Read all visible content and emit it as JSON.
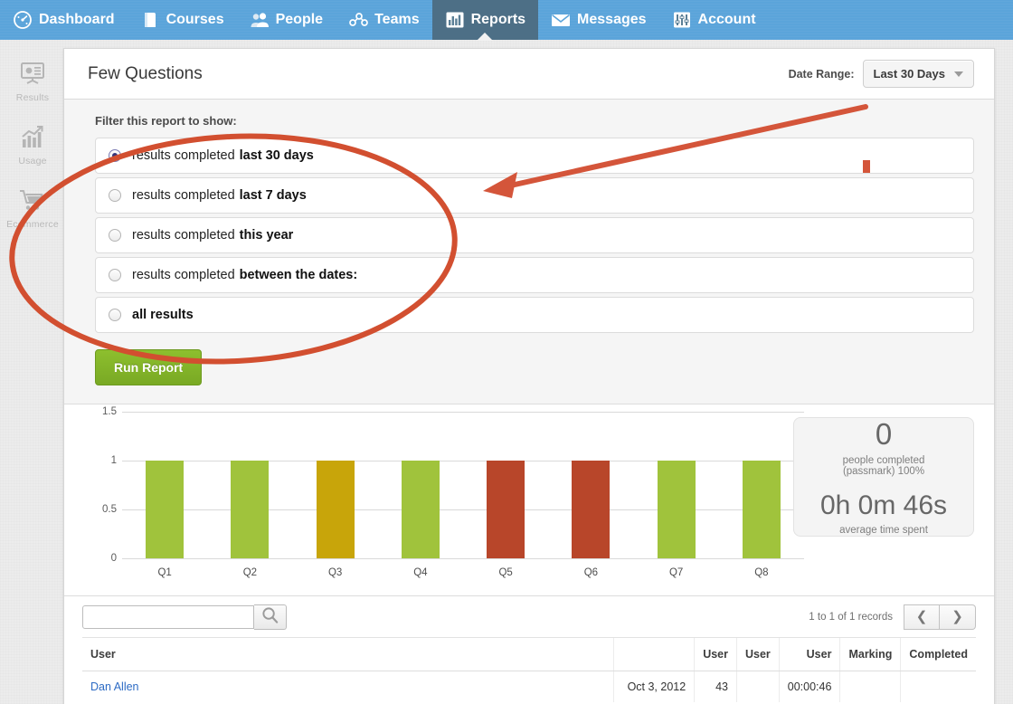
{
  "topnav": {
    "items": [
      {
        "label": "Dashboard",
        "icon": "dashboard-gauge-icon",
        "active": false
      },
      {
        "label": "Courses",
        "icon": "book-icon",
        "active": false
      },
      {
        "label": "People",
        "icon": "people-icon",
        "active": false
      },
      {
        "label": "Teams",
        "icon": "teams-icon",
        "active": false
      },
      {
        "label": "Reports",
        "icon": "bar-chart-icon",
        "active": true
      },
      {
        "label": "Messages",
        "icon": "envelope-icon",
        "active": false
      },
      {
        "label": "Account",
        "icon": "sliders-icon",
        "active": false
      }
    ],
    "background_color": "#5ba4da",
    "active_background_color": "#4d6f86"
  },
  "sidebar": {
    "items": [
      {
        "label": "Results",
        "icon": "presentation-chart-icon"
      },
      {
        "label": "Usage",
        "icon": "trend-up-bars-icon"
      },
      {
        "label": "Ecommerce",
        "icon": "shopping-cart-icon"
      }
    ]
  },
  "header": {
    "title": "Few Questions",
    "date_range_label": "Date Range:",
    "date_range_value": "Last 30 Days",
    "caret_icon": "chevron-down-icon"
  },
  "filter": {
    "heading": "Filter this report to show:",
    "options": [
      {
        "lead": "results completed",
        "strong": "last 30 days",
        "selected": true
      },
      {
        "lead": "results completed",
        "strong": "last 7 days",
        "selected": false
      },
      {
        "lead": "results completed",
        "strong": "this year",
        "selected": false
      },
      {
        "lead": "results completed",
        "strong": "between the dates:",
        "selected": false
      },
      {
        "lead": "",
        "strong": "all results",
        "selected": false
      }
    ],
    "run_button_label": "Run Report"
  },
  "chart_data": {
    "type": "bar",
    "title": "",
    "xlabel": "",
    "ylabel": "",
    "categories": [
      "Q1",
      "Q2",
      "Q3",
      "Q4",
      "Q5",
      "Q6",
      "Q7",
      "Q8"
    ],
    "values": [
      1,
      1,
      1,
      1,
      1,
      1,
      1,
      1
    ],
    "bar_colors": [
      "#a0c33c",
      "#a0c33c",
      "#c8a50a",
      "#a0c33c",
      "#b8462a",
      "#b8462a",
      "#a0c33c",
      "#a0c33c"
    ],
    "ylim": [
      0,
      1.5
    ],
    "yticks": [
      "0",
      "0.5",
      "1",
      "1.5"
    ],
    "ytick_values": [
      0,
      0.5,
      1,
      1.5
    ],
    "grid": true,
    "legend": "none"
  },
  "stats": {
    "count": "0",
    "count_caption_line1": "people completed",
    "count_caption_line2": "(passmark) 100%",
    "time": "0h 0m 46s",
    "time_caption": "average time spent"
  },
  "table": {
    "search_value": "",
    "search_placeholder": "",
    "search_icon": "magnifier-icon",
    "records_text": "1 to 1 of 1 records",
    "prev_icon": "chevron-left-icon",
    "next_icon": "chevron-right-icon",
    "columns": [
      "User",
      "",
      "User",
      "User",
      "User",
      "Marking",
      "Completed"
    ],
    "rows": [
      [
        "Dan Allen",
        "Oct 3, 2012",
        "43",
        "",
        "00:00:46",
        "",
        ""
      ]
    ]
  },
  "annotations": {
    "ellipse_color": "#d24f30",
    "arrow_color": "#d4553a",
    "tick_mark_color": "#d4553a"
  }
}
